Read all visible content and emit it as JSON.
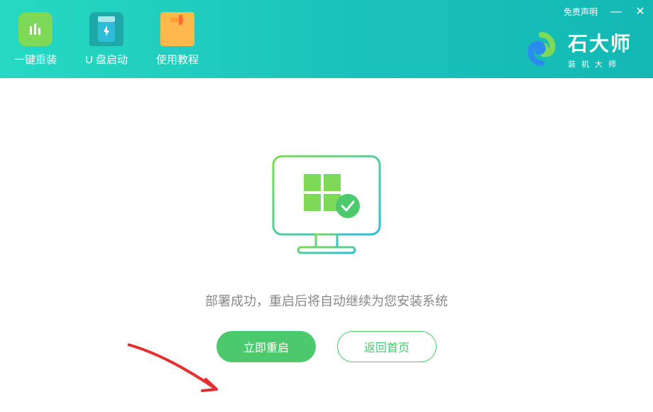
{
  "header": {
    "tabs": [
      {
        "label": "一键重装",
        "icon": "bars-icon"
      },
      {
        "label": "U 盘启动",
        "icon": "usb-icon"
      },
      {
        "label": "使用教程",
        "icon": "book-icon"
      }
    ],
    "disclaimer": "免责声明"
  },
  "logo": {
    "title": "石大师",
    "subtitle": "装机大师"
  },
  "content": {
    "status_text": "部署成功，重启后将自动继续为您安装系统",
    "restart_label": "立即重启",
    "home_label": "返回首页"
  }
}
